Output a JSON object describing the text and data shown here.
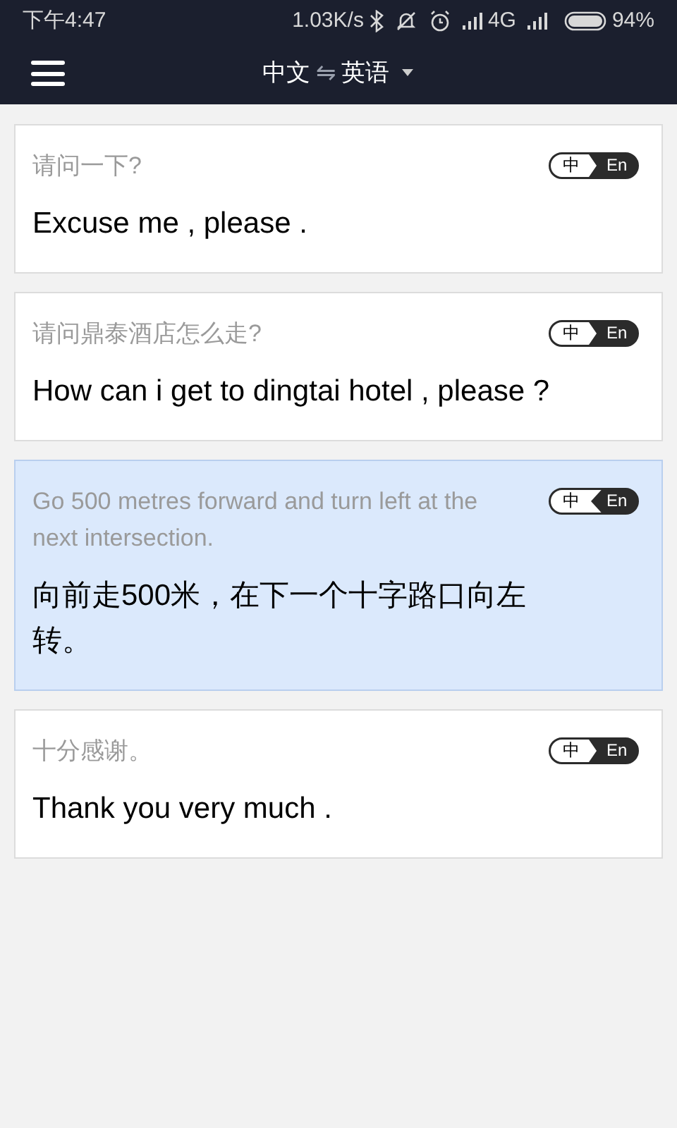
{
  "status_bar": {
    "time": "下午4:47",
    "speed": "1.03K/s",
    "network": "4G",
    "battery": "94%"
  },
  "header": {
    "source_lang": "中文",
    "target_lang": "英语",
    "swap": "⇋"
  },
  "entries": [
    {
      "source": "请问一下?",
      "translation": "Excuse me , please .",
      "reversed": false,
      "selected": false,
      "toggle": {
        "left": "中",
        "right": "En"
      }
    },
    {
      "source": "请问鼎泰酒店怎么走?",
      "translation": "How can i get to dingtai hotel , please ?",
      "reversed": false,
      "selected": false,
      "toggle": {
        "left": "中",
        "right": "En"
      }
    },
    {
      "source": "Go 500 metres forward and turn left at the next intersection.",
      "translation": "向前走500米，在下一个十字路口向左转。",
      "reversed": true,
      "selected": true,
      "toggle": {
        "left": "中",
        "right": "En"
      }
    },
    {
      "source": "十分感谢。",
      "translation": "Thank you very much .",
      "reversed": false,
      "selected": false,
      "toggle": {
        "left": "中",
        "right": "En"
      }
    }
  ]
}
